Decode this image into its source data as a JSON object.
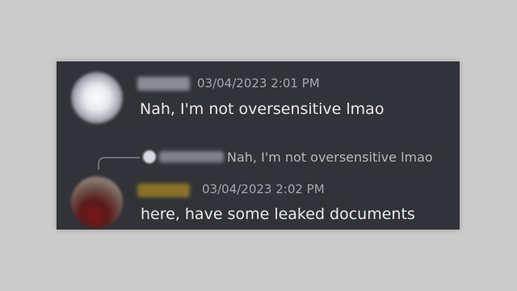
{
  "messages": [
    {
      "timestamp": "03/04/2023 2:01 PM",
      "content": "Nah, I'm not oversensitive lmao"
    },
    {
      "reply_preview": "Nah, I'm not oversensitive lmao",
      "timestamp": "03/04/2023 2:02 PM",
      "content": "here, have some leaked documents"
    }
  ],
  "colors": {
    "background": "#cbcbcb",
    "panel": "#313338",
    "message_text": "#e8e9eb",
    "timestamp_text": "#a4a7ad",
    "second_username": "#8a7328"
  }
}
